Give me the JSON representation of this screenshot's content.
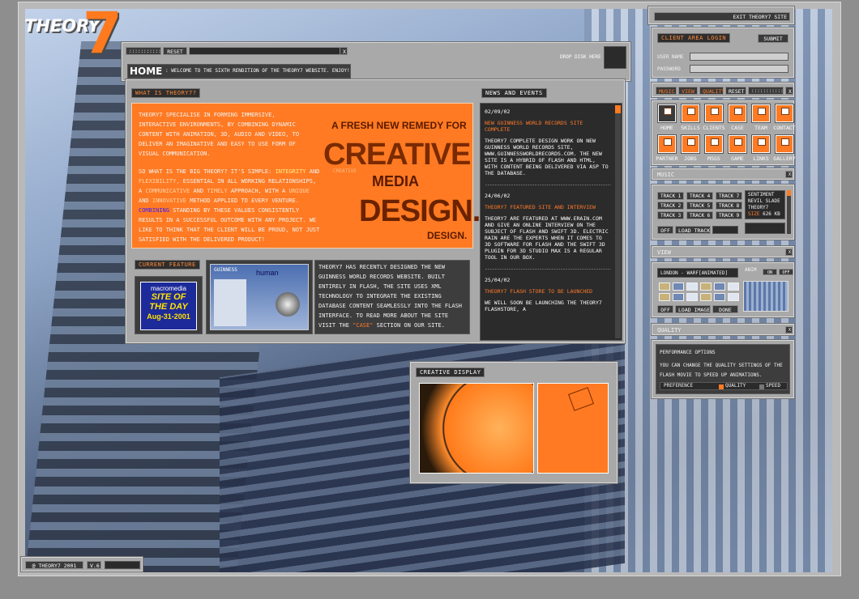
{
  "logo": {
    "word": "THEORY",
    "seven": "7"
  },
  "top_controls": {
    "dots": ":::::::::::",
    "reset": "RESET",
    "close": "X",
    "drop_disk": "DROP DISK HERE"
  },
  "home": {
    "title": "HOME",
    "subtitle": ": WELCOME TO THE SIXTH RENDITION OF THE THEORY7 WEBSITE.  ENJOY!"
  },
  "what": {
    "tag": "WHAT IS THEORY7?",
    "p1": "THEORY7 SPECIALISE IN FORMING IMMERSIVE, INTERACTIVE ENVIRONMENTS, BY COMBINING DYNAMIC CONTENT WITH ANIMATION, 3D, AUDIO AND VIDEO, TO DELIVER AN IMAGINATIVE AND EASY TO USE FORM OF VISUAL COMMUNICATION.",
    "p2_a": "SO WHAT IS THE BIG THEORY?  IT'S SIMPLE:",
    "p2_integrity": "INTEGRITY",
    "p2_and1": "AND",
    "p2_flexibility": "FLEXIBILITY,",
    "p2_b": "ESSENTIAL IN ALL WORKING RELATIONSHIPS, A",
    "p2_communicative": "COMMUNICATIVE",
    "p2_and2": "AND",
    "p2_timely": "TIMELY",
    "p2_c": "APPROACH, WITH A",
    "p2_unique": "UNIQUE",
    "p2_and3": "AND",
    "p2_innovative": "INNOVATIVE",
    "p2_d": "METHOD APPLIED TO EVERY VENTURE.",
    "p2_combining": "COMBINING",
    "p2_e": "STANDING BY THESE VALUES CONSISTENTLY RESULTS IN A SUCCESSFUL OUTCOME WITH ANY PROJECT.  WE LIKE TO THINK THAT THE CLIENT WILL BE PROUD, NOT JUST SATISFIED WITH THE DELIVERED PRODUCT!",
    "poster": {
      "line1": "A FRESH NEW REMEDY FOR",
      "line2": "CREATIVE",
      "line3": "MEDIA",
      "line4": "DESIGN.",
      "small1": "CREATIVE",
      "small2": "DESIGN."
    }
  },
  "feature": {
    "tag": "CURRENT FEATURE",
    "badge_brand": "macromedia",
    "badge_line1": "SITE OF",
    "badge_line2": "THE DAY",
    "badge_date": "Aug-31-2001",
    "shot_label_a": "GUINNESS",
    "shot_label_b": "human",
    "desc": "THEORY7 HAS RECENTLY DESIGNED THE NEW GUINNESS WORLD RECORDS WEBSITE.  BUILT ENTIRELY IN FLASH, THE SITE USES XML TECHNOLOGY TO INTEGRATE THE EXISTING DATABASE CONTENT SEAMLESSLY INTO THE FLASH INTERFACE.  TO READ MORE ABOUT THE SITE VISIT THE",
    "desc_link": "\"CASE\"",
    "desc_end": "SECTION ON OUR SITE."
  },
  "news": {
    "tag": "NEWS AND EVENTS",
    "items": [
      {
        "date": "02/09/02",
        "title": "NEW GUINNESS WORLD RECORDS SITE COMPLETE",
        "body": "THEORY7 COMPLETE DESIGN WORK ON NEW GUINNESS WORLD RECORDS SITE, WWW.GUINNESSWORLDRECORDS.COM. THE NEW SITE IS A HYBRID OF FLASH AND HTML, WITH CONTENT BEING DELIVERED VIA ASP TO THE DATABASE."
      },
      {
        "date": "24/06/02",
        "title": "THEORY7 FEATURED SITE AND INTERVIEW",
        "body": "THEORY7 ARE FEATURED AT WWW.ERAIN.COM AND GIVE AN ONLINE INTERVIEW ON THE SUBJECT OF FLASH AND SWIFT 3D.  ELECTRIC RAIN ARE THE EXPERTS WHEN IT COMES TO 3D SOFTWARE FOR FLASH AND THE SWIFT 3D PLUGIN FOR 3D STUDIO MAX IS A REGULAR TOOL IN OUR BOX."
      },
      {
        "date": "25/04/02",
        "title": "THEORY7 FLASH STORE TO BE LAUNCHED",
        "body": "WE WILL SOON BE LAUNCHING THE THEORY7 FLASHSTORE, A"
      }
    ],
    "separator": "--------------------------------------------------------"
  },
  "display": {
    "tag": "CREATIVE DISPLAY"
  },
  "exit": {
    "label": "EXIT THEORY7 SITE"
  },
  "login": {
    "tag": "CLIENT AREA LOGIN",
    "submit": "SUBMIT",
    "user_label": "USER NAME",
    "pass_label": "PASSWORD",
    "user_value": "",
    "pass_value": ""
  },
  "tabs": [
    "MUSIC",
    "VIEW",
    "QUALITY",
    "RESET"
  ],
  "tabs_dots": ":::::::::::",
  "nav": [
    "HOME",
    "SKILLS",
    "CLIENTS",
    "CASE",
    "TEAM",
    "CONTACT",
    "PARTNER",
    "JOBS",
    "MSGS",
    "GAME",
    "LINKS",
    "GALLERY"
  ],
  "music": {
    "tag": "MUSIC",
    "tracks": [
      "TRACK 1",
      "TRACK 4",
      "TRACK 7",
      "TRACK 2",
      "TRACK 5",
      "TRACK 8",
      "TRACK 3",
      "TRACK 6",
      "TRACK 9"
    ],
    "info": [
      "SENTIMENT",
      "NEVIL SLADE",
      "THEORY7"
    ],
    "size_label": "SIZE",
    "size_value": "626 KB",
    "off": "OFF",
    "load": "LOAD TRACK"
  },
  "view": {
    "tag": "VIEW",
    "title": "LONDON - WARF[ANIMATED]",
    "anim": "ANIM",
    "on": "ON",
    "off": "OFF",
    "off2": "OFF",
    "load": "LOAD IMAGE",
    "done": "DONE"
  },
  "quality": {
    "tag": "QUALITY",
    "heading": "PERFORMANCE OPTIONS",
    "desc": "YOU CAN CHANGE THE QUALITY SETTINGS OF THE FLASH MOVIE TO SPEED UP ANIMATIONS.",
    "pref": "PREFERENCE",
    "q": "QUALITY",
    "s": "SPEED"
  },
  "footer": {
    "copyright": "@ THEORY7 2001",
    "version": "V.6"
  }
}
